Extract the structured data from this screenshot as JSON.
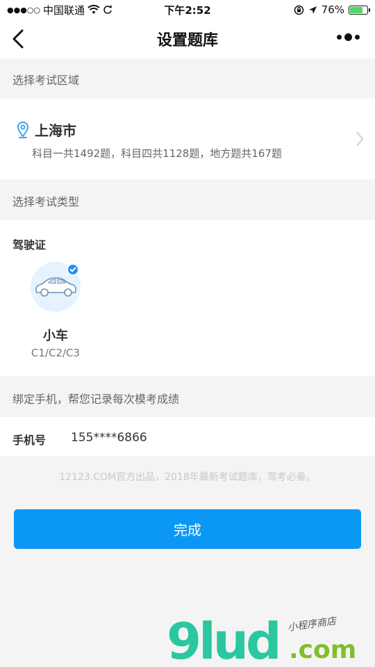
{
  "status_bar": {
    "carrier": "中国联通",
    "time": "下午2:52",
    "battery": "76%",
    "battery_level": 0.76
  },
  "nav": {
    "title": "设置题库"
  },
  "region": {
    "section_label": "选择考试区域",
    "city": "上海市",
    "description": "科目一共1492题，科目四共1128题，地方题共167题"
  },
  "exam_type": {
    "section_label": "选择考试类型",
    "license_label": "驾驶证",
    "vehicles": [
      {
        "name": "小车",
        "code": "C1/C2/C3",
        "selected": true
      }
    ]
  },
  "phone": {
    "section_label": "绑定手机，帮您记录每次模考成绩",
    "label": "手机号",
    "value": "155****6866"
  },
  "footer_note": "12123.COM官方出品，2018年最新考试题库，驾考必备。",
  "done_button": "完成",
  "watermark": {
    "logo": "9lud",
    "suffix": ".com",
    "tagline": "小程序商店"
  },
  "colors": {
    "primary": "#0b98f4",
    "check": "#1f8ff0",
    "location_icon": "#3aa6ea"
  }
}
